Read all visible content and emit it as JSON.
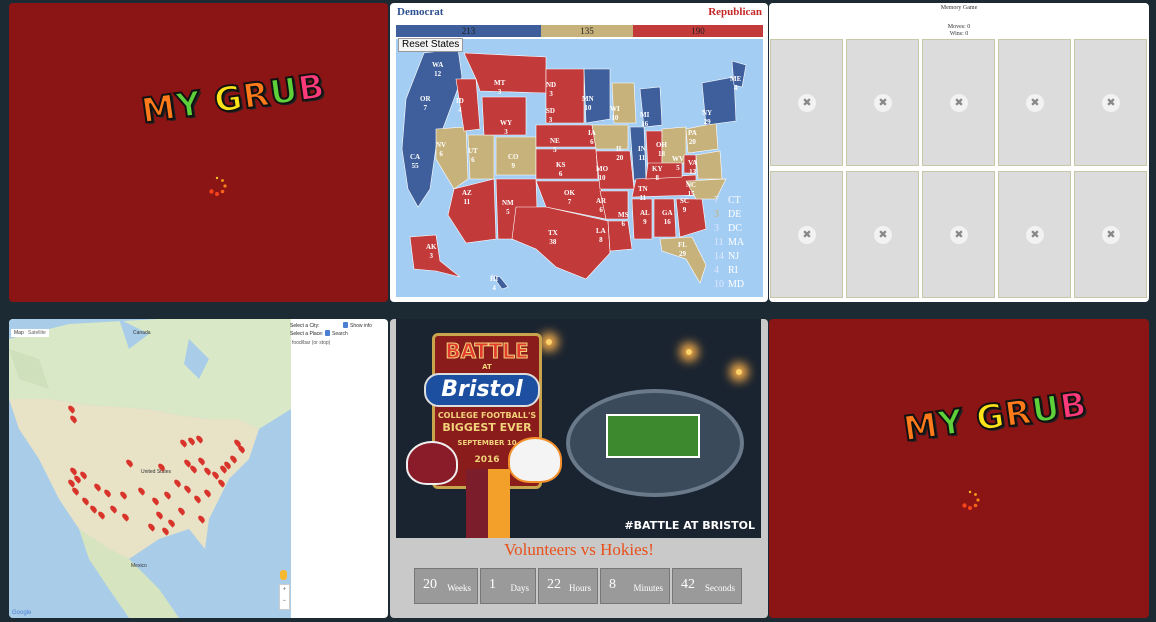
{
  "tiles": {
    "mygrub_top": {
      "logo": "MY GRUB"
    },
    "election": {
      "left_party": "Democrat",
      "right_party": "Republican",
      "votes": {
        "dem": "213",
        "toss": "135",
        "rep": "190"
      },
      "reset_label": "Reset States",
      "colors": {
        "dem": "#3e5f9c",
        "toss": "#c8b27c",
        "rep": "#c23a3a",
        "ocean": "#a4cdf4"
      },
      "states": [
        {
          "abbr": "WA",
          "ev": "12"
        },
        {
          "abbr": "OR",
          "ev": "7"
        },
        {
          "abbr": "CA",
          "ev": "55"
        },
        {
          "abbr": "NV",
          "ev": "6"
        },
        {
          "abbr": "ID",
          "ev": "4"
        },
        {
          "abbr": "MT",
          "ev": "3"
        },
        {
          "abbr": "WY",
          "ev": "3"
        },
        {
          "abbr": "UT",
          "ev": "6"
        },
        {
          "abbr": "AZ",
          "ev": "11"
        },
        {
          "abbr": "CO",
          "ev": "9"
        },
        {
          "abbr": "NM",
          "ev": "5"
        },
        {
          "abbr": "ND",
          "ev": "3"
        },
        {
          "abbr": "SD",
          "ev": "3"
        },
        {
          "abbr": "NE",
          "ev": "5"
        },
        {
          "abbr": "KS",
          "ev": "6"
        },
        {
          "abbr": "OK",
          "ev": "7"
        },
        {
          "abbr": "TX",
          "ev": "38"
        },
        {
          "abbr": "MN",
          "ev": "10"
        },
        {
          "abbr": "IA",
          "ev": "6"
        },
        {
          "abbr": "MO",
          "ev": "10"
        },
        {
          "abbr": "AR",
          "ev": "6"
        },
        {
          "abbr": "LA",
          "ev": "8"
        },
        {
          "abbr": "WI",
          "ev": "10"
        },
        {
          "abbr": "IL",
          "ev": "20"
        },
        {
          "abbr": "MS",
          "ev": "6"
        },
        {
          "abbr": "MI",
          "ev": "16"
        },
        {
          "abbr": "IN",
          "ev": "11"
        },
        {
          "abbr": "KY",
          "ev": "8"
        },
        {
          "abbr": "TN",
          "ev": "11"
        },
        {
          "abbr": "AL",
          "ev": "9"
        },
        {
          "abbr": "OH",
          "ev": "18"
        },
        {
          "abbr": "GA",
          "ev": "16"
        },
        {
          "abbr": "FL",
          "ev": "29"
        },
        {
          "abbr": "SC",
          "ev": "9"
        },
        {
          "abbr": "NC",
          "ev": "15"
        },
        {
          "abbr": "WV",
          "ev": "5"
        },
        {
          "abbr": "VA",
          "ev": "13"
        },
        {
          "abbr": "PA",
          "ev": "20"
        },
        {
          "abbr": "NY",
          "ev": "29"
        },
        {
          "abbr": "ME",
          "ev": "4"
        },
        {
          "abbr": "AK",
          "ev": "3"
        },
        {
          "abbr": "HI",
          "ev": "4"
        }
      ],
      "small_states": [
        {
          "ev": "7",
          "abbr": "CT"
        },
        {
          "ev": "3",
          "abbr": "DE"
        },
        {
          "ev": "3",
          "abbr": "DC"
        },
        {
          "ev": "11",
          "abbr": "MA"
        },
        {
          "ev": "14",
          "abbr": "NJ"
        },
        {
          "ev": "4",
          "abbr": "RI"
        },
        {
          "ev": "10",
          "abbr": "MD"
        }
      ]
    },
    "memory": {
      "title": "Memory Game",
      "moves": "Moves: 0",
      "wins": "Wins: 0",
      "card_icon": "broken-image-icon"
    },
    "map": {
      "select_city": "Select a City:",
      "select_place": "Select a Place:",
      "show_info": "Show info",
      "search": "Search",
      "place_placeholder": "food/bar (or stop)",
      "map_button": "Map",
      "satellite_button": "Satellite",
      "labels": {
        "canada": "Canada",
        "us": "United States",
        "mexico": "Mexico",
        "google": "Google"
      }
    },
    "event": {
      "poster": {
        "battle": "BATTLE",
        "at": "AT",
        "venue": "Bristol",
        "tagline1": "COLLEGE FOOTBALL'S",
        "tagline2": "BIGGEST EVER",
        "date": "SEPTEMBER 10",
        "year": "2016",
        "hashtag": "#BATTLE AT BRISTOL"
      },
      "headline": "Volunteers vs Hokies!",
      "countdown": [
        {
          "num": "20",
          "unit": "Weeks"
        },
        {
          "num": "1",
          "unit": "Days"
        },
        {
          "num": "22",
          "unit": "Hours"
        },
        {
          "num": "8",
          "unit": "Minutes"
        },
        {
          "num": "42",
          "unit": "Seconds"
        }
      ]
    },
    "mygrub_bottom": {
      "logo": "MY GRUB"
    }
  }
}
